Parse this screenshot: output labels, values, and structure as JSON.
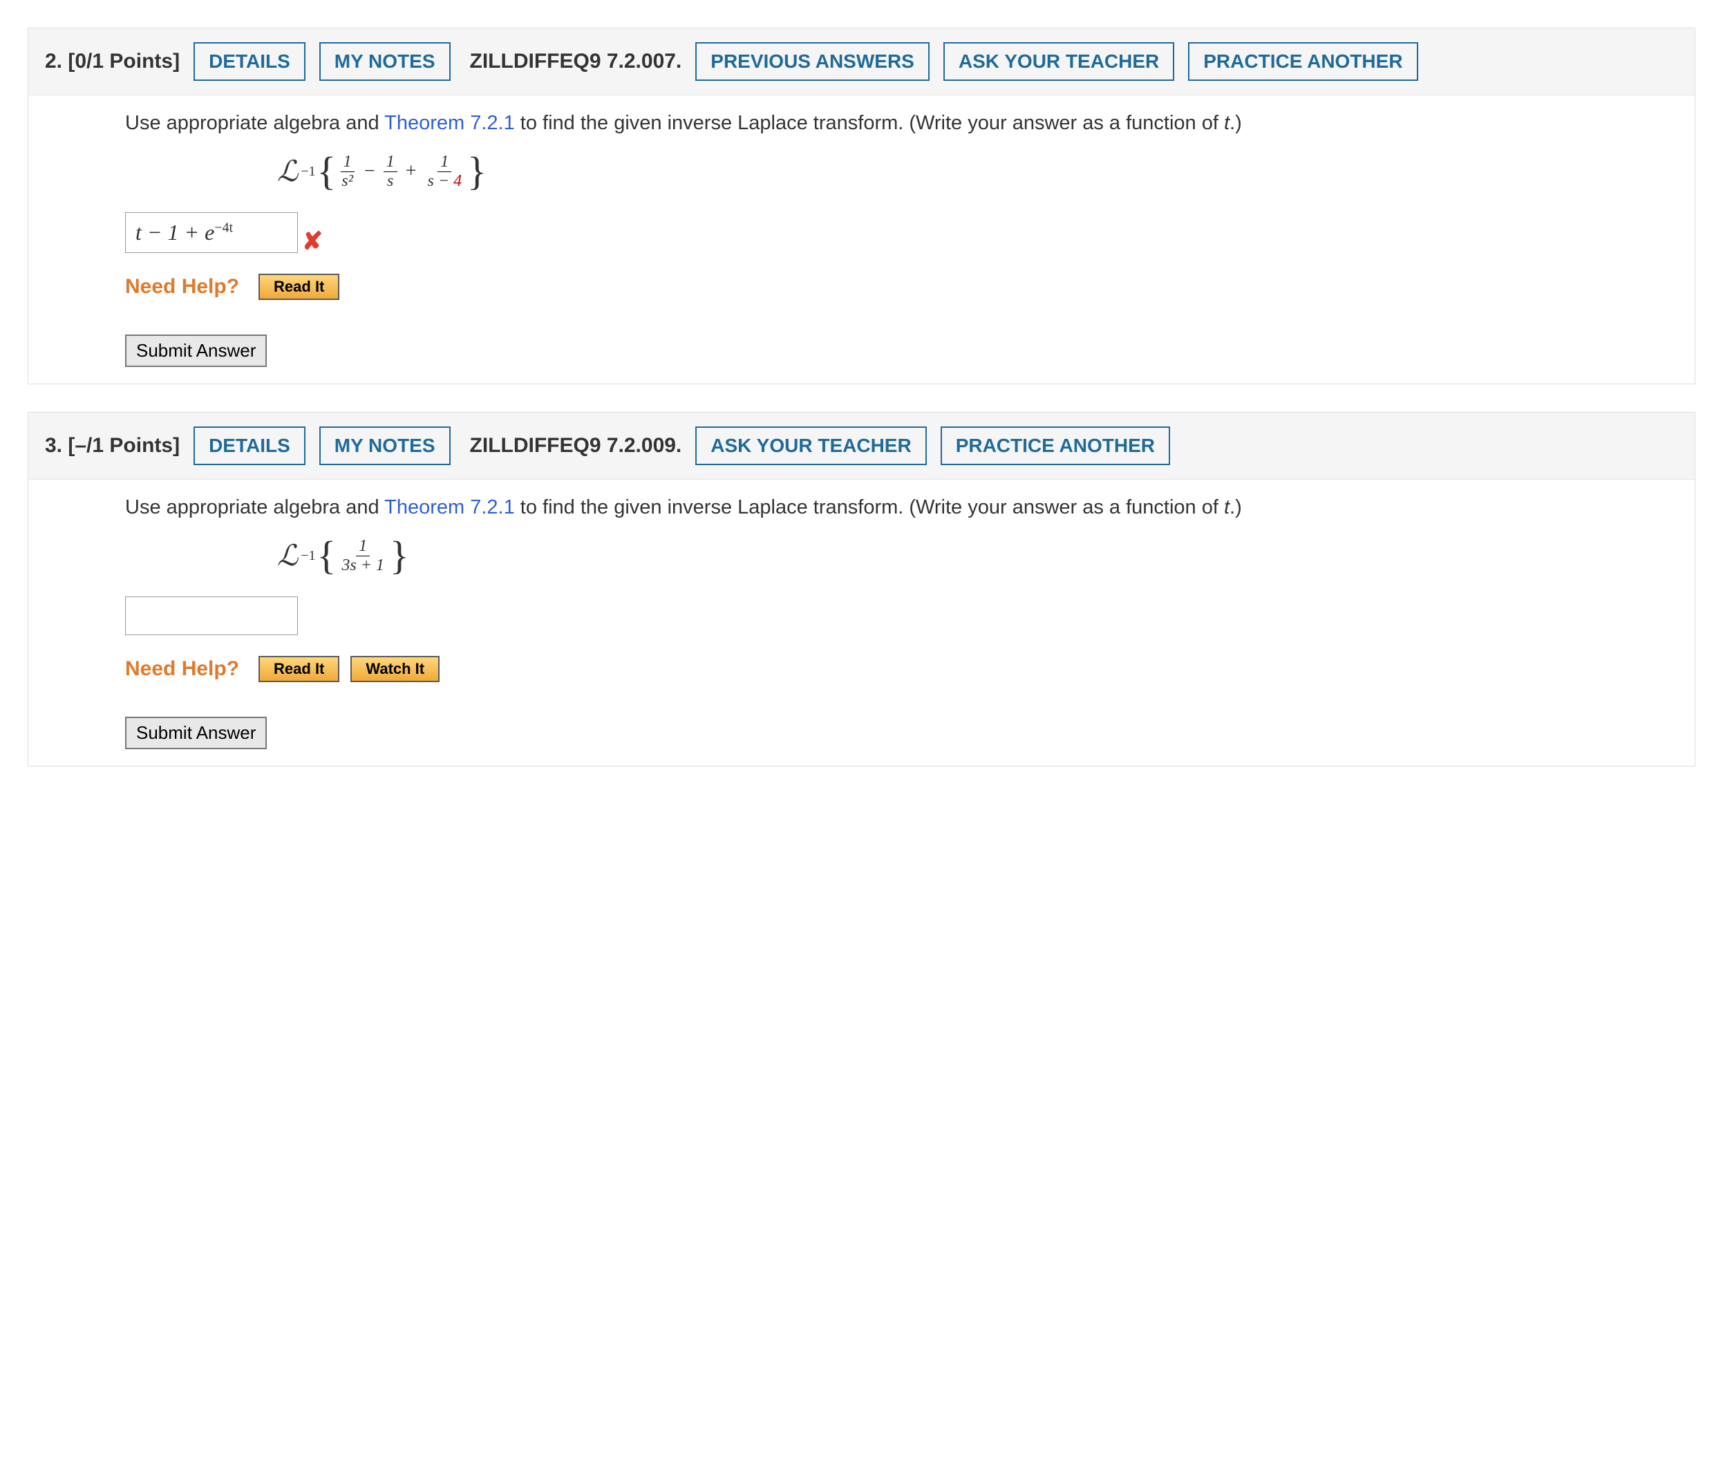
{
  "labels": {
    "details": "DETAILS",
    "my_notes": "MY NOTES",
    "previous_answers": "PREVIOUS ANSWERS",
    "ask_teacher": "ASK YOUR TEACHER",
    "practice_another": "PRACTICE ANOTHER",
    "need_help": "Need Help?",
    "read_it": "Read It",
    "watch_it": "Watch It",
    "submit": "Submit Answer"
  },
  "questions": [
    {
      "number": "2.",
      "points": "[0/1 Points]",
      "reference": "ZILLDIFFEQ9 7.2.007.",
      "prompt_pre": "Use appropriate algebra and ",
      "theorem": "Theorem 7.2.1",
      "prompt_post": " to find the given inverse Laplace transform. (Write your answer as a function of ",
      "prompt_var": "t",
      "prompt_end": ".)",
      "expr": {
        "f1_num": "1",
        "f1_den": "s²",
        "op1": "−",
        "f2_num": "1",
        "f2_den": "s",
        "op2": "+",
        "f3_num": "1",
        "f3_den_a": "s − ",
        "f3_den_red": "4"
      },
      "answer_value_html": "t − 1 + e<sup>−4t</sup>",
      "is_wrong": true,
      "has_previous": true,
      "has_watch": false
    },
    {
      "number": "3.",
      "points": "[–/1 Points]",
      "reference": "ZILLDIFFEQ9 7.2.009.",
      "prompt_pre": "Use appropriate algebra and ",
      "theorem": "Theorem 7.2.1",
      "prompt_post": " to find the given inverse Laplace transform. (Write your answer as a function of ",
      "prompt_var": "t",
      "prompt_end": ".)",
      "expr": {
        "single_num": "1",
        "single_den": "3s + 1"
      },
      "answer_value_html": "",
      "is_wrong": false,
      "has_previous": false,
      "has_watch": true
    }
  ]
}
